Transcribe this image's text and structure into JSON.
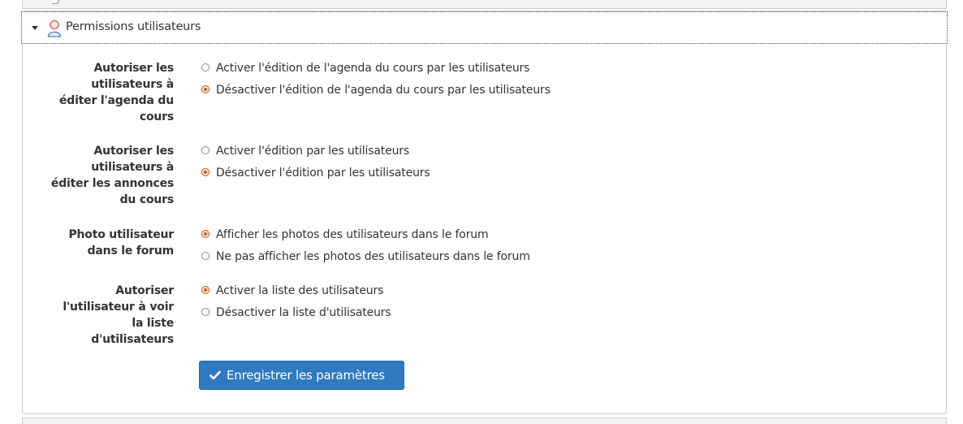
{
  "panel": {
    "title": "Permissions utilisateurs",
    "icon": "user-icon"
  },
  "settings": [
    {
      "label": "Autoriser les utilisateurs à éditer l'agenda du cours",
      "label_lines": [
        "Autoriser les",
        "utilisateurs à",
        "éditer l'agenda du",
        "cours"
      ],
      "options": [
        {
          "text": "Activer l'édition de l'agenda du cours par les utilisateurs",
          "selected": false
        },
        {
          "text": "Désactiver l'édition de l'agenda du cours par les utilisateurs",
          "selected": true
        }
      ]
    },
    {
      "label": "Autoriser les utilisateurs à éditer les annonces du cours",
      "label_lines": [
        "Autoriser les",
        "utilisateurs à",
        "éditer les annonces",
        "du cours"
      ],
      "options": [
        {
          "text": "Activer l'édition par les utilisateurs",
          "selected": false
        },
        {
          "text": "Désactiver l'édition par les utilisateurs",
          "selected": true
        }
      ]
    },
    {
      "label": "Photo utilisateur dans le forum",
      "label_lines": [
        "Photo utilisateur",
        "dans le forum"
      ],
      "options": [
        {
          "text": "Afficher les photos des utilisateurs dans le forum",
          "selected": true
        },
        {
          "text": "Ne pas afficher les photos des utilisateurs dans le forum",
          "selected": false
        }
      ]
    },
    {
      "label": "Autoriser l'utilisateur à voir la liste d'utilisateurs",
      "label_lines": [
        "Autoriser",
        "l'utilisateur à voir",
        "la liste",
        "d'utilisateurs"
      ],
      "options": [
        {
          "text": "Activer la liste des utilisateurs",
          "selected": true
        },
        {
          "text": "Désactiver la liste d'utilisateurs",
          "selected": false
        }
      ]
    }
  ],
  "save_button": {
    "label": "Enregistrer les paramètres",
    "icon": "check-icon",
    "color": "#2f7ac0"
  },
  "colors": {
    "radio_selected": "#d9531e",
    "text": "#333333",
    "border": "#c9c9c9"
  }
}
